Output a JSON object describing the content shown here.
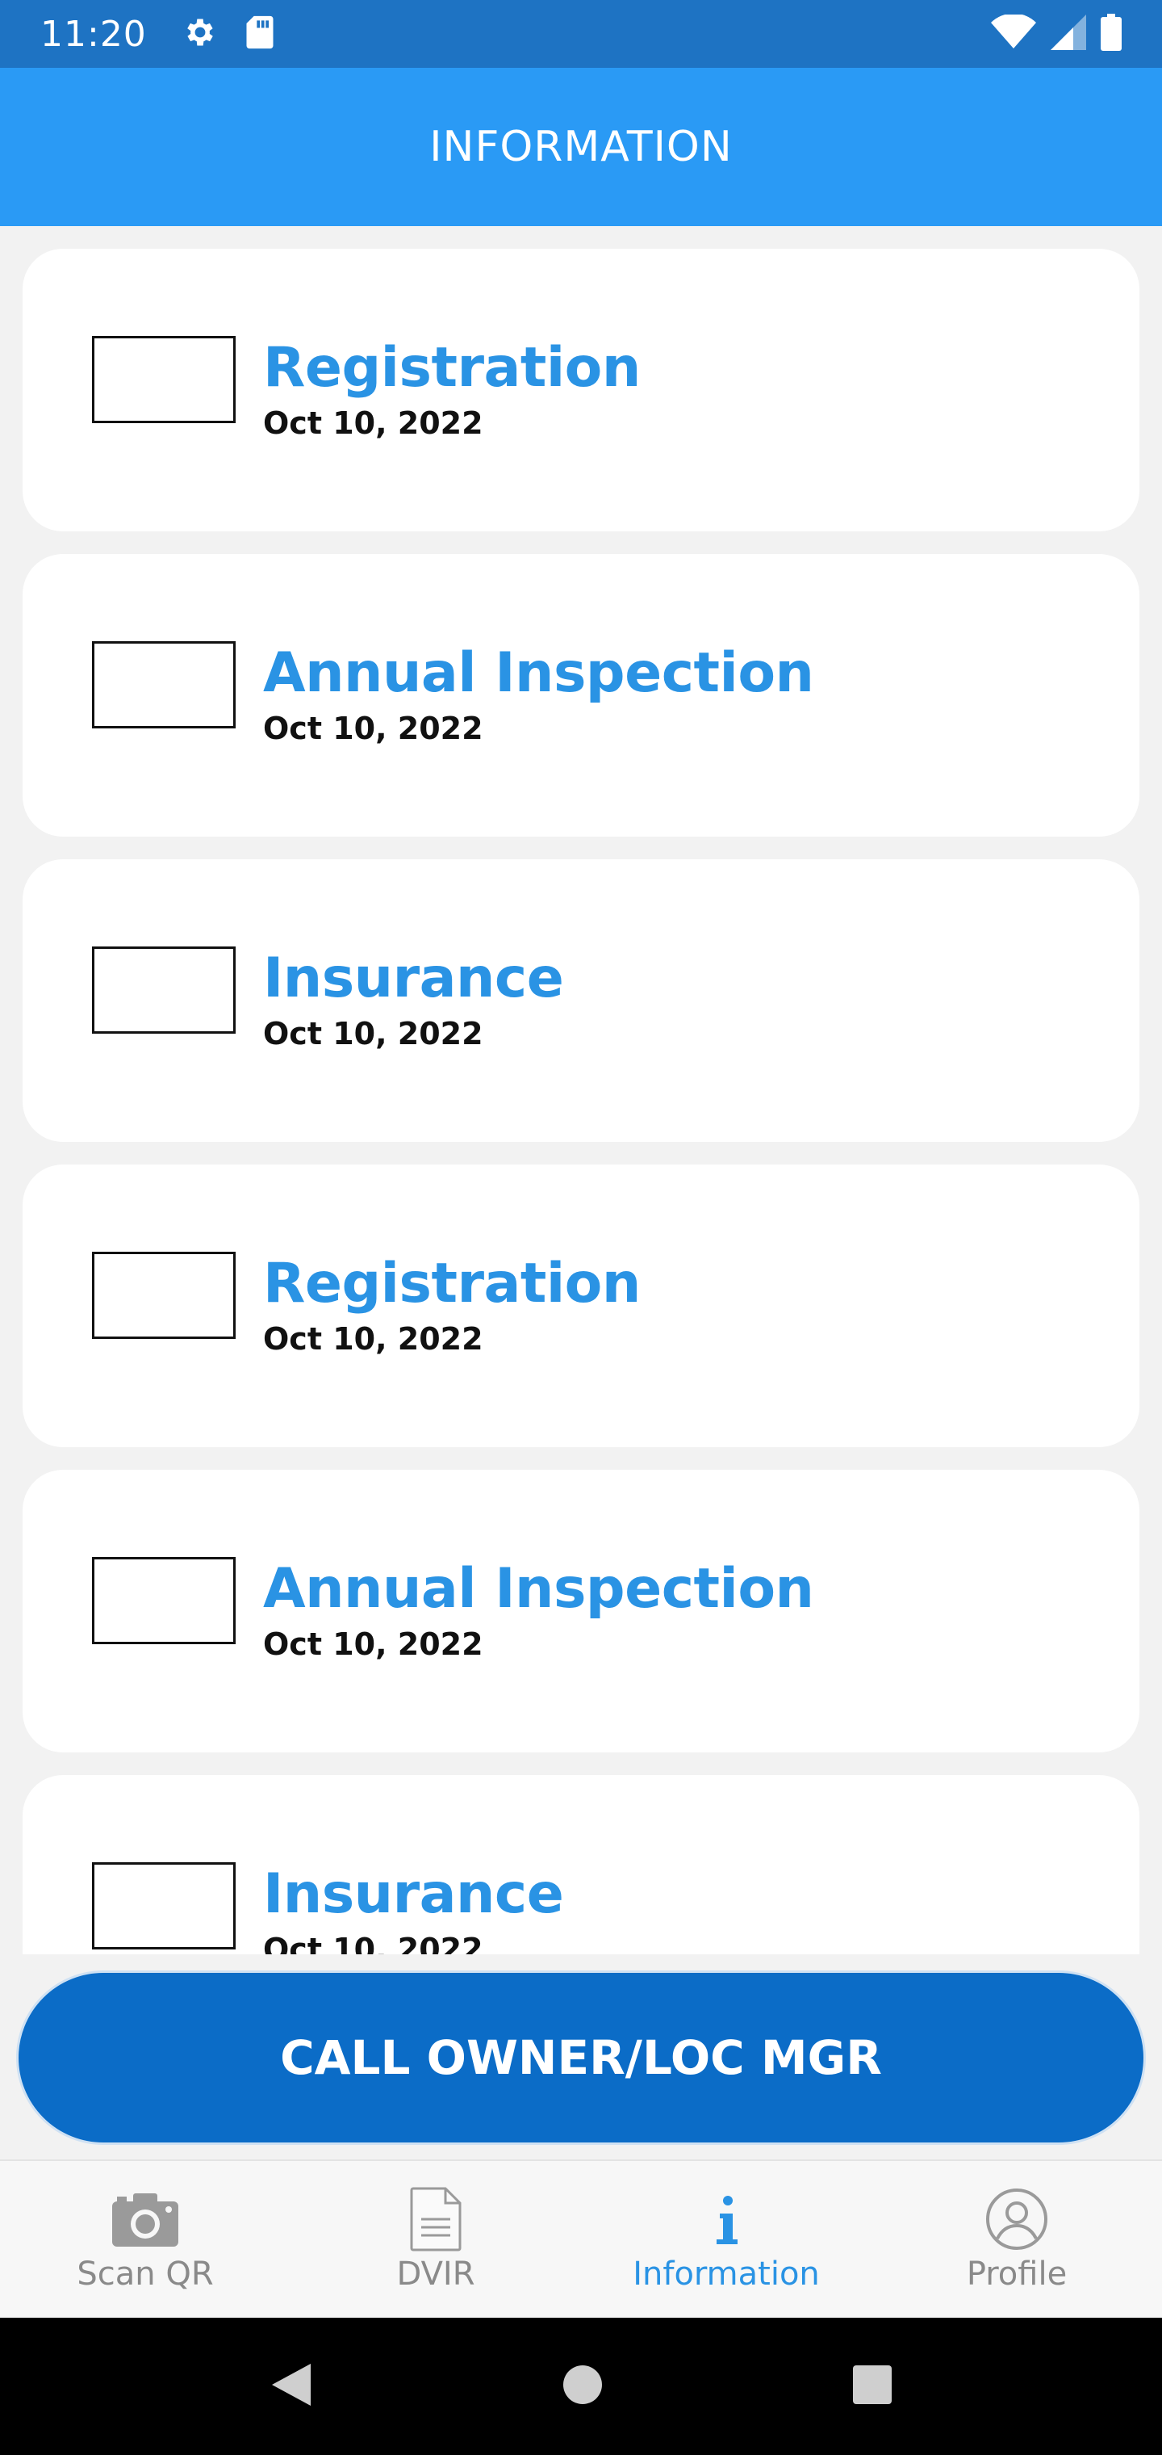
{
  "status_bar": {
    "time": "11:20",
    "icons": [
      "gear-icon",
      "sd-card-icon",
      "wifi-icon",
      "signal-icon",
      "battery-icon"
    ]
  },
  "header": {
    "title": "INFORMATION"
  },
  "documents": [
    {
      "title": "Registration",
      "date": "Oct 10, 2022"
    },
    {
      "title": "Annual Inspection",
      "date": "Oct 10, 2022"
    },
    {
      "title": "Insurance",
      "date": "Oct 10, 2022"
    },
    {
      "title": "Registration",
      "date": "Oct 10, 2022"
    },
    {
      "title": "Annual Inspection",
      "date": "Oct 10, 2022"
    },
    {
      "title": "Insurance",
      "date": "Oct 10, 2022"
    }
  ],
  "call_button": {
    "label": "CALL OWNER/LOC MGR"
  },
  "bottom_nav": {
    "items": [
      {
        "label": "Scan QR",
        "icon": "camera-icon",
        "active": false
      },
      {
        "label": "DVIR",
        "icon": "document-icon",
        "active": false
      },
      {
        "label": "Information",
        "icon": "info-icon",
        "active": true
      },
      {
        "label": "Profile",
        "icon": "profile-icon",
        "active": false
      }
    ]
  },
  "colors": {
    "status_bar": "#1e73c3",
    "header": "#2a9af5",
    "accent": "#2a93e4",
    "button": "#0b6cc7",
    "background": "#f2f2f2"
  }
}
